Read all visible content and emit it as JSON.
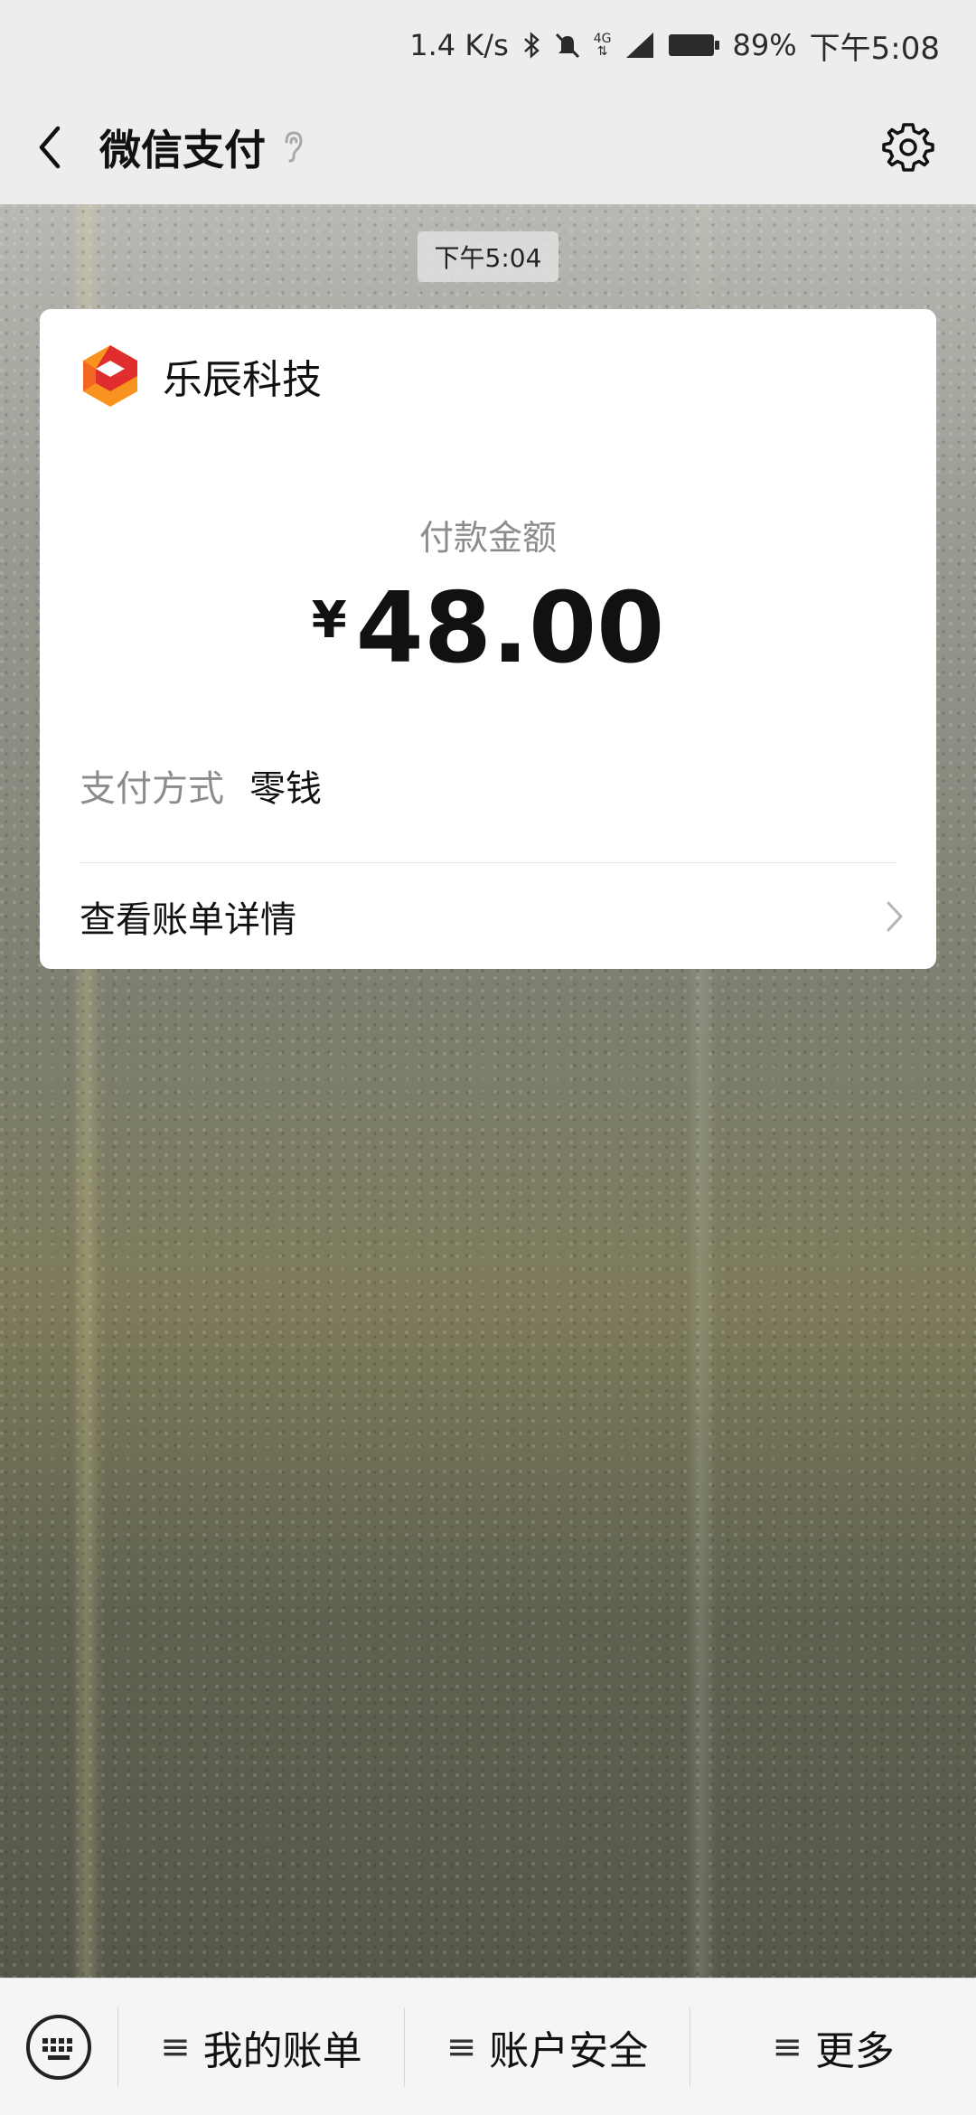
{
  "status_bar": {
    "net_speed": "1.4 K/s",
    "network": "4G",
    "battery": "89%",
    "time": "下午5:08",
    "icons": [
      "bluetooth-icon",
      "mute-icon",
      "network-4g-icon",
      "signal-icon",
      "battery-icon"
    ]
  },
  "header": {
    "title": "微信支付",
    "icons": [
      "back-icon",
      "ear-icon",
      "gear-icon"
    ]
  },
  "chat": {
    "timestamp": "下午5:04",
    "card": {
      "merchant_name": "乐辰科技",
      "amount_label": "付款金额",
      "currency_symbol": "¥",
      "amount": "48.00",
      "method_label": "支付方式",
      "method_value": "零钱",
      "detail_link": "查看账单详情"
    }
  },
  "bottom_menu": {
    "items": [
      {
        "label": "我的账单",
        "icon": "≡"
      },
      {
        "label": "账户安全",
        "icon": "≡"
      },
      {
        "label": "更多",
        "icon": "≡"
      }
    ]
  },
  "colors": {
    "bar_bg": "#ededed",
    "card_bg": "#ffffff",
    "label_gray": "#8c8c8c",
    "logo_orange": "#f26522",
    "logo_red": "#e02d2d"
  }
}
